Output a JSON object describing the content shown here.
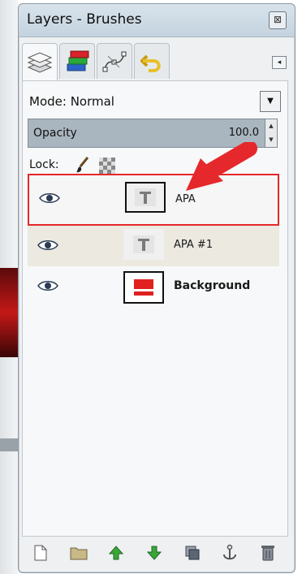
{
  "window": {
    "title": "Layers - Brushes",
    "close_glyph": "⊠"
  },
  "tabs": [
    {
      "icon": "layers-icon",
      "active": true
    },
    {
      "icon": "channels-icon",
      "active": false
    },
    {
      "icon": "paths-icon",
      "active": false
    },
    {
      "icon": "undo-history-icon",
      "active": false
    }
  ],
  "tab_menu_glyph": "◂",
  "mode": {
    "label": "Mode: Normal",
    "dropdown_glyph": "▼"
  },
  "opacity": {
    "label": "Opacity",
    "value": "100.0"
  },
  "lock": {
    "label": "Lock:"
  },
  "layers": [
    {
      "name": "APA",
      "visible": true,
      "thumbnail": "text-layer-icon",
      "highlighted": true
    },
    {
      "name": "APA #1",
      "visible": true,
      "thumbnail": "text-layer-icon",
      "highlighted": false
    },
    {
      "name": "Background",
      "visible": true,
      "thumbnail": "red-image-thumbnail",
      "highlighted": false
    }
  ],
  "bottom_buttons": [
    "new-layer-icon",
    "new-layer-group-icon",
    "raise-layer-icon",
    "lower-layer-icon",
    "duplicate-layer-icon",
    "anchor-layer-icon",
    "delete-layer-icon"
  ],
  "colors": {
    "annotation_red": "#e5282b",
    "brand_red": "#e12020",
    "opacity_bar": "#a9b5bf"
  }
}
